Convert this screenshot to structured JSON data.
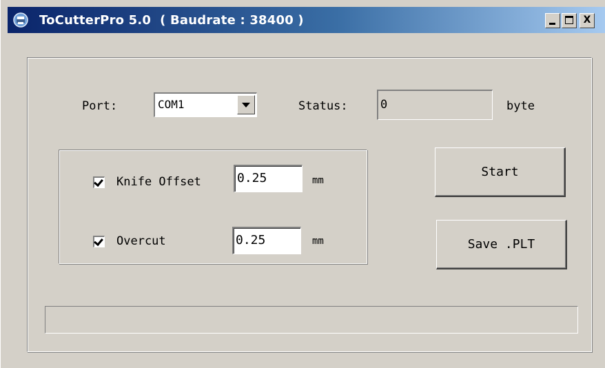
{
  "window": {
    "title": "ToCutterPro 5.0  ( Baudrate : 38400 )",
    "app_icon": "printer-icon",
    "title_buttons": [
      "minimize-icon",
      "maximize-icon",
      "close-icon"
    ],
    "close_glyph": "X"
  },
  "connection": {
    "port_label": "Port:",
    "port_value": "COM1",
    "status_label": "Status:",
    "status_value": "0",
    "status_unit": "byte"
  },
  "options": {
    "knife_offset": {
      "checked": true,
      "label": "Knife Offset",
      "value": "0.25",
      "unit": "mm"
    },
    "overcut": {
      "checked": true,
      "label": "Overcut",
      "value": "0.25",
      "unit": "mm"
    }
  },
  "actions": {
    "start_label": "Start",
    "save_label": "Save .PLT"
  },
  "progress": {
    "fraction": 0
  },
  "colors": {
    "face": "#d4d0c8",
    "title_start": "#0a246a",
    "title_end": "#a6caf0"
  }
}
